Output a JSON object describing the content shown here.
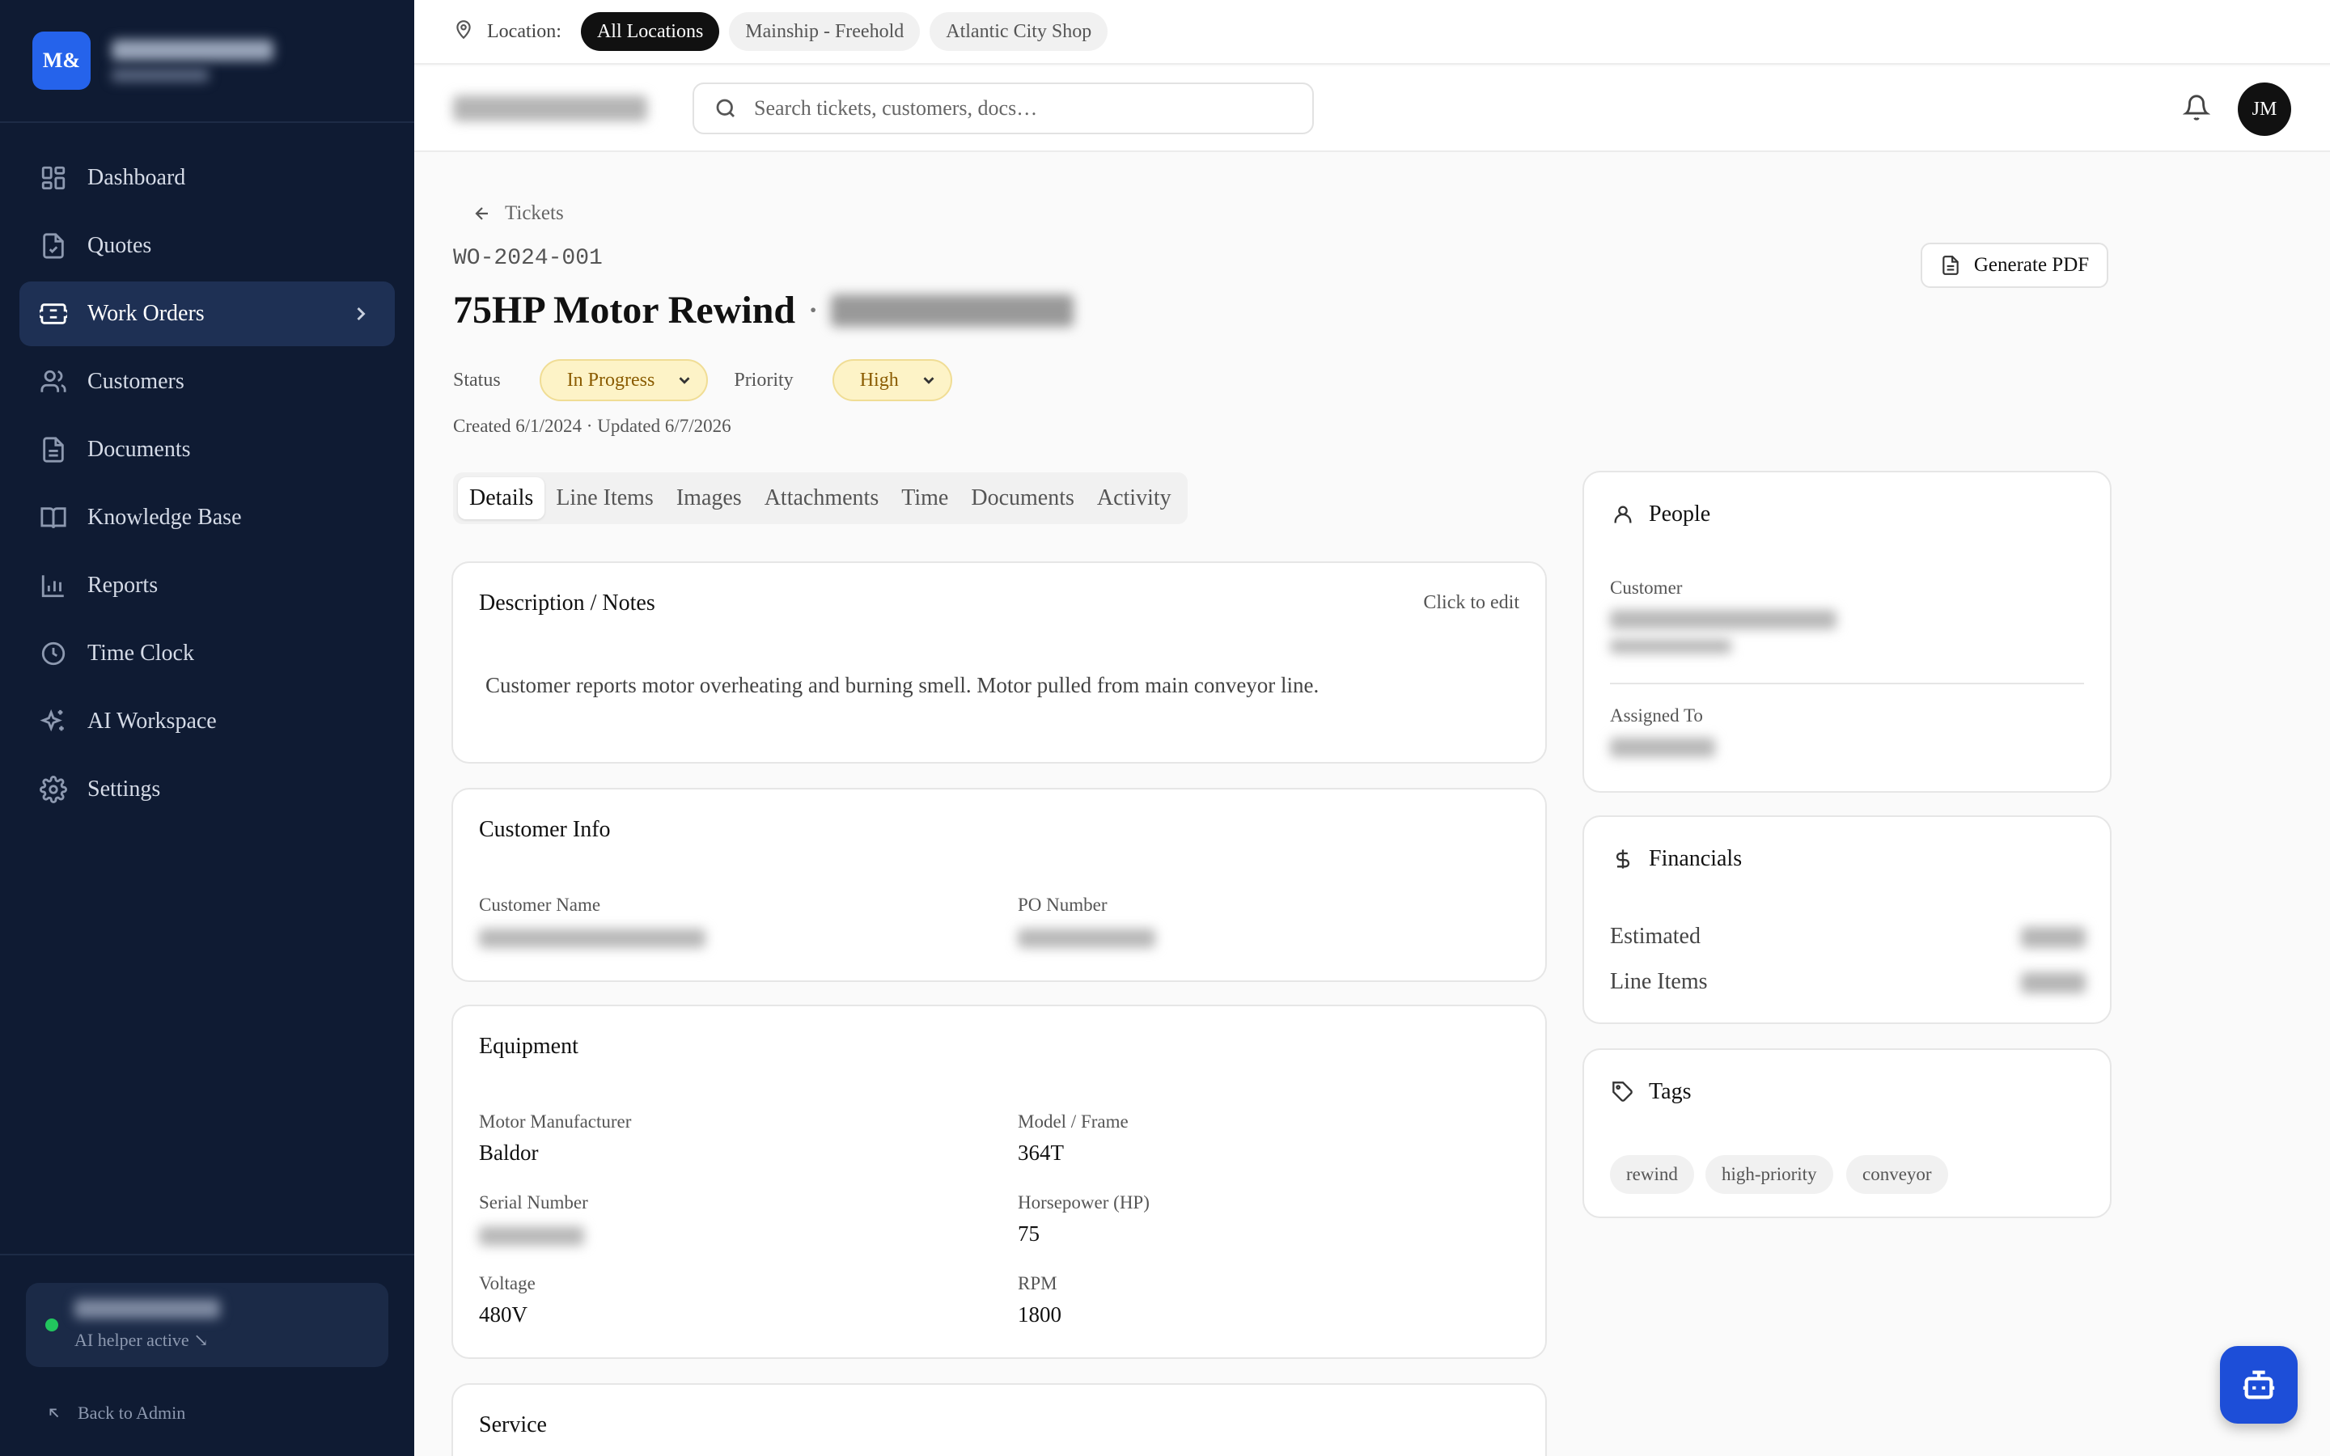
{
  "sidebar": {
    "logo": "M&",
    "items": [
      {
        "label": "Dashboard",
        "icon": "dashboard-icon"
      },
      {
        "label": "Quotes",
        "icon": "quote-icon"
      },
      {
        "label": "Work Orders",
        "icon": "ticket-icon",
        "active": true
      },
      {
        "label": "Customers",
        "icon": "users-icon"
      },
      {
        "label": "Documents",
        "icon": "document-icon"
      },
      {
        "label": "Knowledge Base",
        "icon": "book-icon"
      },
      {
        "label": "Reports",
        "icon": "chart-icon"
      },
      {
        "label": "Time Clock",
        "icon": "clock-icon"
      },
      {
        "label": "AI Workspace",
        "icon": "sparkles-icon"
      },
      {
        "label": "Settings",
        "icon": "gear-icon"
      }
    ],
    "ai_status": "AI helper active ↘",
    "back_label": "Back to Admin"
  },
  "location_bar": {
    "label": "Location:",
    "chips": [
      "All Locations",
      "Mainship - Freehold",
      "Atlantic City Shop"
    ],
    "active_chip": "All Locations"
  },
  "header": {
    "search_placeholder": "Search tickets, customers, docs…",
    "avatar_initials": "JM"
  },
  "ticket": {
    "back_label": "Tickets",
    "id": "WO-2024-001",
    "title": "75HP Motor Rewind",
    "title_sep": "·",
    "generate_pdf_label": "Generate PDF",
    "status_label": "Status",
    "status_value": "In Progress",
    "priority_label": "Priority",
    "priority_value": "High",
    "created_text": "Created 6/1/2024 · Updated 6/7/2026",
    "tabs": [
      "Details",
      "Line Items",
      "Images",
      "Attachments",
      "Time",
      "Documents",
      "Activity"
    ],
    "active_tab": "Details"
  },
  "description": {
    "title": "Description / Notes",
    "action": "Click to edit",
    "text": "Customer reports motor overheating and burning smell. Motor pulled from main conveyor line."
  },
  "customer_info": {
    "title": "Customer Info",
    "customer_name_label": "Customer Name",
    "po_number_label": "PO Number"
  },
  "equipment": {
    "title": "Equipment",
    "manufacturer_label": "Motor Manufacturer",
    "manufacturer_value": "Baldor",
    "model_label": "Model / Frame",
    "model_value": "364T",
    "serial_label": "Serial Number",
    "hp_label": "Horsepower (HP)",
    "hp_value": "75",
    "voltage_label": "Voltage",
    "voltage_value": "480V",
    "rpm_label": "RPM",
    "rpm_value": "1800"
  },
  "service": {
    "title": "Service"
  },
  "people": {
    "title": "People",
    "customer_label": "Customer",
    "assigned_label": "Assigned To"
  },
  "financials": {
    "title": "Financials",
    "estimated_label": "Estimated",
    "line_items_label": "Line Items"
  },
  "tags": {
    "title": "Tags",
    "items": [
      "rewind",
      "high-priority",
      "conveyor"
    ]
  },
  "colors": {
    "sidebar_bg": "#0f1b33",
    "accent": "#2563eb",
    "status_bg": "#fdf3c7",
    "status_text": "#8a5b00",
    "online_dot": "#22c55e"
  }
}
